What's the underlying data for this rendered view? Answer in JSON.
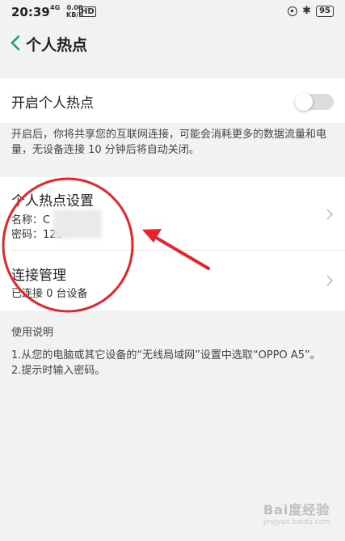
{
  "status_bar": {
    "time": "20:39",
    "network": "4G",
    "speed_value": "0.00",
    "speed_unit": "KB/S",
    "hd": "HD",
    "battery": "95"
  },
  "header": {
    "title": "个人热点"
  },
  "hotspot_toggle": {
    "label": "开启个人热点",
    "enabled": false
  },
  "description": "开启后，你将共享您的互联网连接，可能会消耗更多的数据流量和电量，无设备连接 10 分钟后将自动关闭。",
  "settings": {
    "title": "个人热点设置",
    "name_label": "名称：",
    "name_value": "C",
    "password_label": "密码：",
    "password_value": "123"
  },
  "connection": {
    "title": "连接管理",
    "status": "已连接 0 台设备"
  },
  "usage": {
    "title": "使用说明",
    "line1": "1.从您的电脑或其它设备的“无线局域网”设置中选取“OPPO A5”。",
    "line2": "2.提示时输入密码。"
  },
  "watermark": {
    "text": "Bai度经验",
    "sub": "jingyan.baidu.com"
  },
  "colors": {
    "accent": "#1aa26a",
    "annotation": "#e8242a",
    "background": "#f2f2f2"
  }
}
